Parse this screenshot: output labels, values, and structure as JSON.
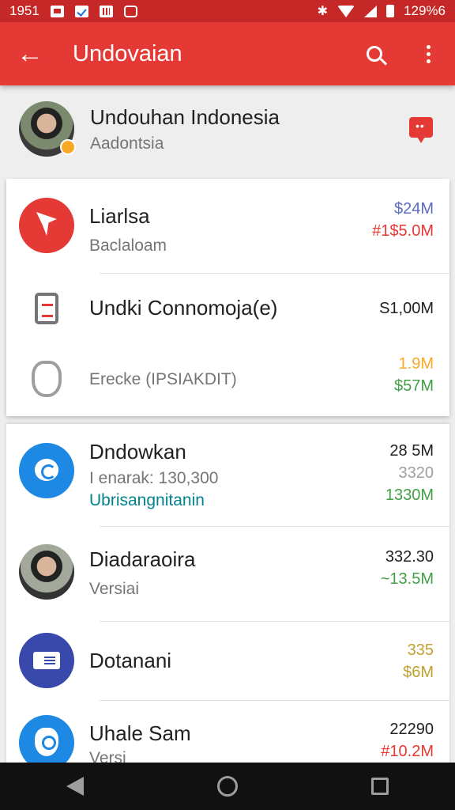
{
  "status_bar": {
    "time": "1951",
    "battery_text": "129%6"
  },
  "app_bar": {
    "title": "Undovaian"
  },
  "profile": {
    "name": "Undouhan Indonesia",
    "subtitle": "Aadontsia"
  },
  "card1": {
    "rows": [
      {
        "title": "Liarlsa",
        "subtitle": "Baclaloam",
        "values": [
          "$24M",
          "#1$5.0M"
        ],
        "value_colors": [
          "#5c6bc0",
          "#e53935"
        ],
        "icon": "red-app-icon"
      },
      {
        "title": "Undki Connomoja(e)",
        "subtitle": "",
        "values": [
          "S1,00M"
        ],
        "value_colors": [
          "#212121"
        ],
        "icon": "document-icon"
      },
      {
        "title": "",
        "subtitle": "Erecke (IPSIAKDIT)",
        "values": [
          "1.9M",
          "$57M"
        ],
        "value_colors": [
          "#f9a825",
          "#43a047"
        ],
        "icon": "shield-outline-icon"
      }
    ]
  },
  "card2": {
    "rows": [
      {
        "title": "Dndowkan",
        "subtitle": "I enarak: 130,300",
        "subtitle2": "Ubrisangnitanin",
        "values": [
          "28 5M",
          "3320",
          "1330M"
        ],
        "value_colors": [
          "#212121",
          "#9e9e9e",
          "#43a047"
        ],
        "icon": "camera-chat-icon"
      },
      {
        "title": "Diadaraoira",
        "subtitle": "Versiai",
        "values": [
          "332.30",
          "~13.5M"
        ],
        "value_colors": [
          "#212121",
          "#43a047"
        ],
        "icon": "avatar-icon"
      },
      {
        "title": "Dotanani",
        "subtitle": "",
        "values": [
          "335",
          "$6M"
        ],
        "value_colors": [
          "#c0a030",
          "#c0a030"
        ],
        "icon": "card-icon"
      },
      {
        "title": "Uhale Sam",
        "subtitle": "Versi",
        "values": [
          "22290",
          "#10.2M"
        ],
        "value_colors": [
          "#212121",
          "#e53935"
        ],
        "icon": "shield-blue-icon"
      }
    ]
  },
  "colors": {
    "status_bar": "#c62828",
    "app_bar": "#e53935",
    "accent_blue": "#1e88e5"
  }
}
